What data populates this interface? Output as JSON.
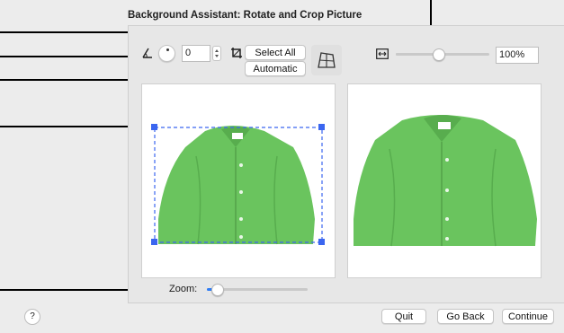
{
  "dialog": {
    "title": "Background Assistant: Rotate and Crop Picture"
  },
  "toolbar": {
    "rotation_value": "0",
    "select_all_label": "Select All",
    "automatic_label": "Automatic",
    "zoom_percent": "100%",
    "zoom_slider_fraction": 0.45
  },
  "preview": {
    "zoom_label": "Zoom:",
    "zoom_slider_fraction": 0.1
  },
  "footer": {
    "help_label": "?",
    "quit_label": "Quit",
    "go_back_label": "Go Back",
    "continue_label": "Continue"
  },
  "colors": {
    "accent": "#2f7df6",
    "selection": "#3b66f0",
    "shirt": "#6ac45e"
  },
  "icons": {
    "rotate": "angle-icon",
    "crop": "crop-icon",
    "perspective": "perspective-grid-icon",
    "fit": "fit-width-icon"
  }
}
